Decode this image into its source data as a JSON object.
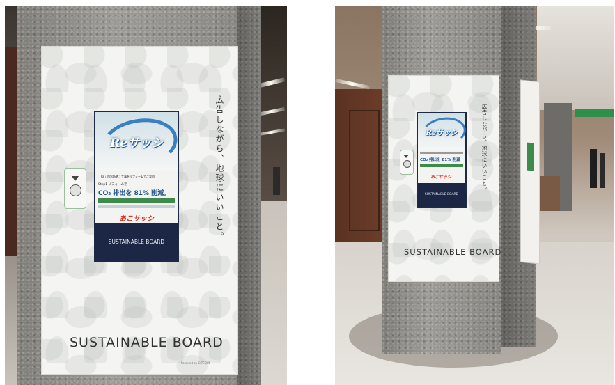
{
  "photos": [
    {
      "id_label": "left",
      "poster": {
        "tagline": "広告しながら、地球にいいこと。",
        "board_name": "SUSTAINABLE BOARD",
        "powered_by": "Powered by GITEQUE",
        "screen": {
          "logo": "Reサッシ",
          "line1": "「Re」内窓断熱：工事をリフォームでご案内",
          "line2": "Step1 リフォームで",
          "co2": "CO₂ 排出を 81% 削減。",
          "brand": "あこサッシ",
          "bottom_title": "SUSTAINABLE BOARD"
        }
      }
    },
    {
      "id_label": "right",
      "poster": {
        "tagline": "広告しながら、地球にいいこと。",
        "board_name": "SUSTAINABLE BOARD",
        "screen": {
          "logo": "Reサッシ",
          "co2": "CO₂ 排出を 81% 削減",
          "brand": "あこサッシ",
          "bottom_title": "SUSTAINABLE BOARD"
        }
      }
    }
  ],
  "colors": {
    "screen_navy": "#1b2745",
    "logo_blue": "#3a7fbf",
    "brand_red": "#d4321f",
    "band_green": "#3d8a4a",
    "sign_green": "#2f8f4a"
  }
}
